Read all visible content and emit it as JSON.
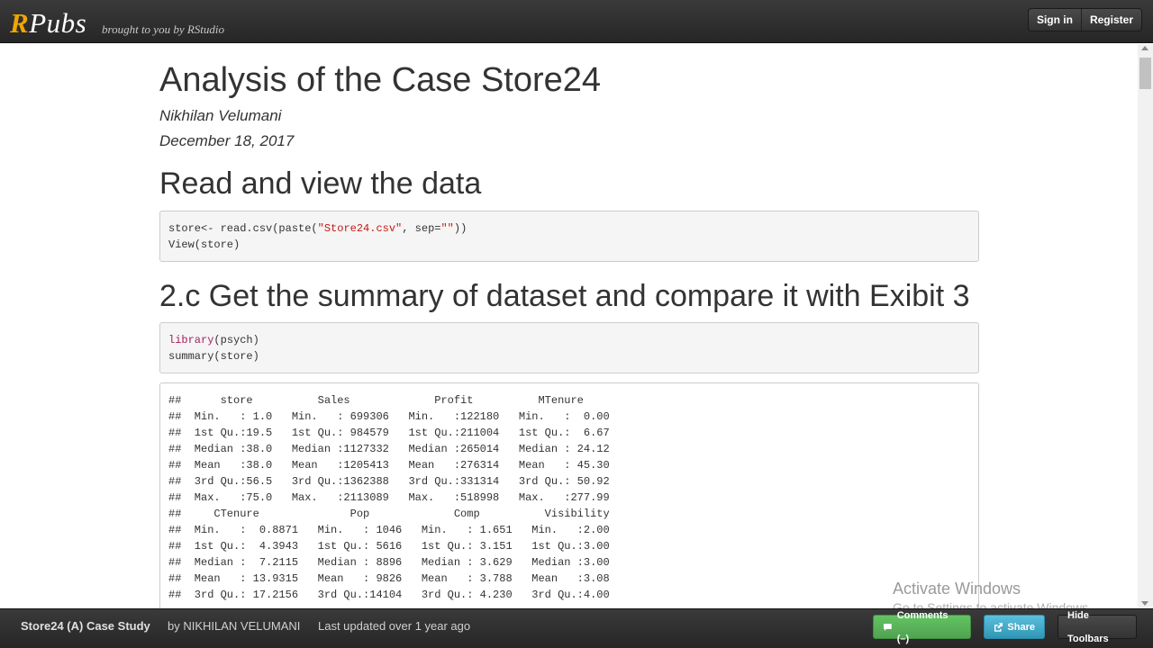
{
  "header": {
    "logo_r": "R",
    "logo_rest": "Pubs",
    "tagline": "brought to you by RStudio",
    "sign_in": "Sign in",
    "register": "Register"
  },
  "doc": {
    "title": "Analysis of the Case Store24",
    "author": "Nikhilan Velumani",
    "date": "December 18, 2017",
    "section1": "Read and view the data",
    "section2": "2.c Get the summary of dataset and compare it with Exibit 3",
    "code1": {
      "l1_a": "store<- read.csv(paste(",
      "l1_str1": "\"Store24.csv\"",
      "l1_b": ", sep=",
      "l1_str2": "\"\"",
      "l1_c": "))",
      "l2": "View(store)"
    },
    "code2": {
      "l1_kw": "library",
      "l1_rest": "(psych)",
      "l2": "summary(store)"
    },
    "output_lines": [
      "##      store          Sales             Profit          MTenure      ",
      "##  Min.   : 1.0   Min.   : 699306   Min.   :122180   Min.   :  0.00  ",
      "##  1st Qu.:19.5   1st Qu.: 984579   1st Qu.:211004   1st Qu.:  6.67  ",
      "##  Median :38.0   Median :1127332   Median :265014   Median : 24.12  ",
      "##  Mean   :38.0   Mean   :1205413   Mean   :276314   Mean   : 45.30  ",
      "##  3rd Qu.:56.5   3rd Qu.:1362388   3rd Qu.:331314   3rd Qu.: 50.92  ",
      "##  Max.   :75.0   Max.   :2113089   Max.   :518998   Max.   :277.99  ",
      "##     CTenure              Pop             Comp          Visibility  ",
      "##  Min.   :  0.8871   Min.   : 1046   Min.   : 1.651   Min.   :2.00  ",
      "##  1st Qu.:  4.3943   1st Qu.: 5616   1st Qu.: 3.151   1st Qu.:3.00  ",
      "##  Median :  7.2115   Median : 8896   Median : 3.629   Median :3.00  ",
      "##  Mean   : 13.9315   Mean   : 9826   Mean   : 3.788   Mean   :3.08  ",
      "##  3rd Qu.: 17.2156   3rd Qu.:14104   3rd Qu.: 4.230   3rd Qu.:4.00  "
    ]
  },
  "footer": {
    "title": "Store24 (A) Case Study",
    "by": "by NIKHILAN VELUMANI",
    "updated": "Last updated over 1 year ago",
    "comments": "Comments (–)",
    "share": "Share",
    "hide_toolbars": "Hide Toolbars"
  },
  "watermark": {
    "line1": "Activate Windows",
    "line2": "Go to Settings to activate Windows."
  }
}
